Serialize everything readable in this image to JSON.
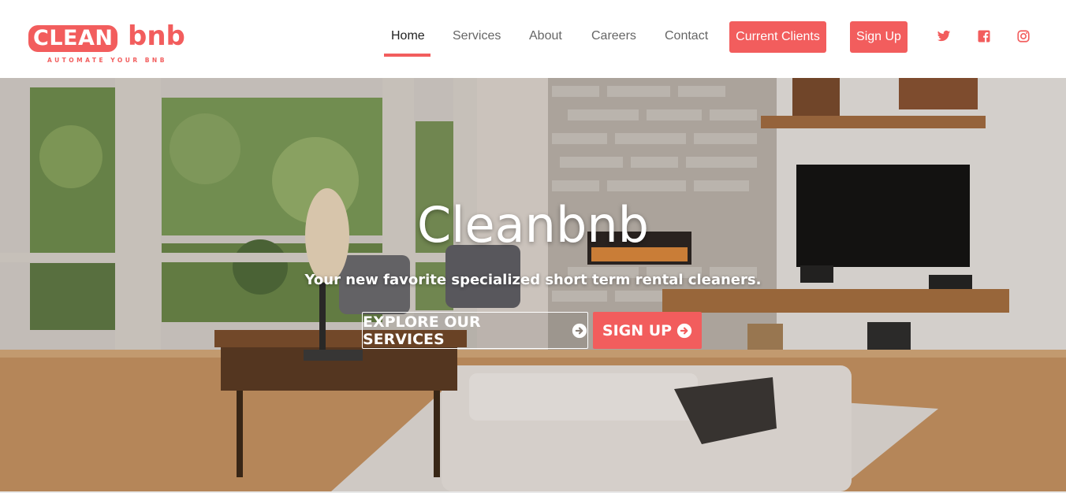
{
  "brand": {
    "logo_box_text": "CLEAN",
    "logo_rest_text": "bnb",
    "logo_tagline": "AUTOMATE YOUR BNB"
  },
  "nav": {
    "links": [
      {
        "label": "Home",
        "active": true
      },
      {
        "label": "Services"
      },
      {
        "label": "About"
      },
      {
        "label": "Careers"
      },
      {
        "label": "Contact"
      }
    ],
    "current_clients_label": "Current Clients",
    "sign_up_label": "Sign Up",
    "social_icons": [
      "twitter-icon",
      "facebook-icon",
      "instagram-icon"
    ]
  },
  "hero": {
    "title": "Cleanbnb",
    "subtitle": "Your new favorite specialized short term rental cleaners.",
    "explore_label": "EXPLORE OUR SERVICES",
    "signup_label": "SIGN UP"
  },
  "colors": {
    "accent": "#f25d5d",
    "nav_text": "#666666",
    "nav_active": "#222222"
  }
}
